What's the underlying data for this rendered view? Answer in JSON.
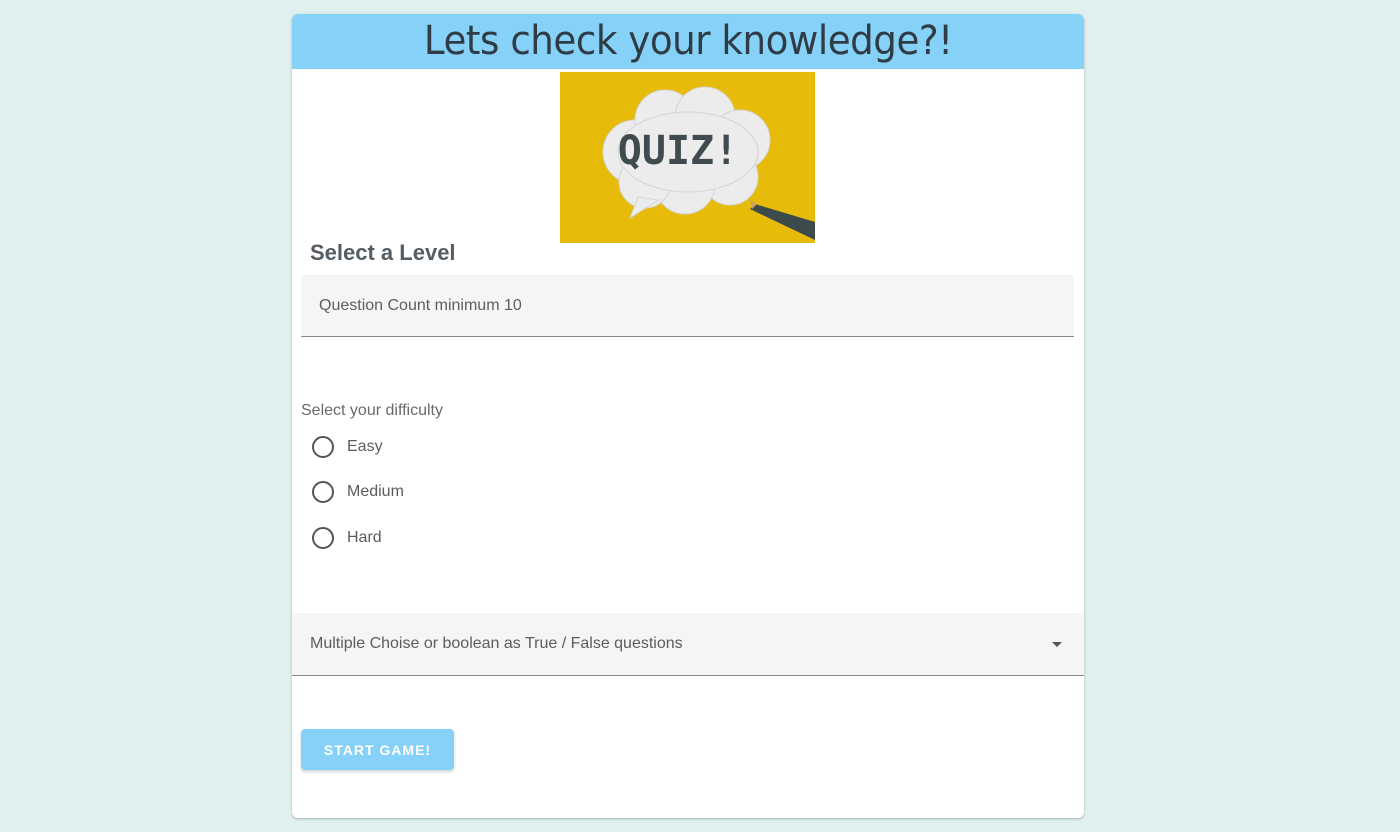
{
  "header": {
    "title": "Lets check your knowledge?!"
  },
  "hero_image": {
    "text": "QUIZ!",
    "background_color": "#e6bb0a"
  },
  "level": {
    "title": "Select a Level"
  },
  "question_count": {
    "placeholder": "Question Count minimum 10",
    "value": ""
  },
  "difficulty": {
    "label": "Select your difficulty",
    "options": [
      "Easy",
      "Medium",
      "Hard"
    ],
    "selected": null
  },
  "question_type": {
    "value": "Multiple Choise or boolean as True / False questions",
    "icon": "dropdown-arrow-icon"
  },
  "start_button": {
    "label": "START GAME!"
  },
  "colors": {
    "page_background": "#dff0ee",
    "accent": "#86d1f7",
    "card": "#ffffff"
  }
}
